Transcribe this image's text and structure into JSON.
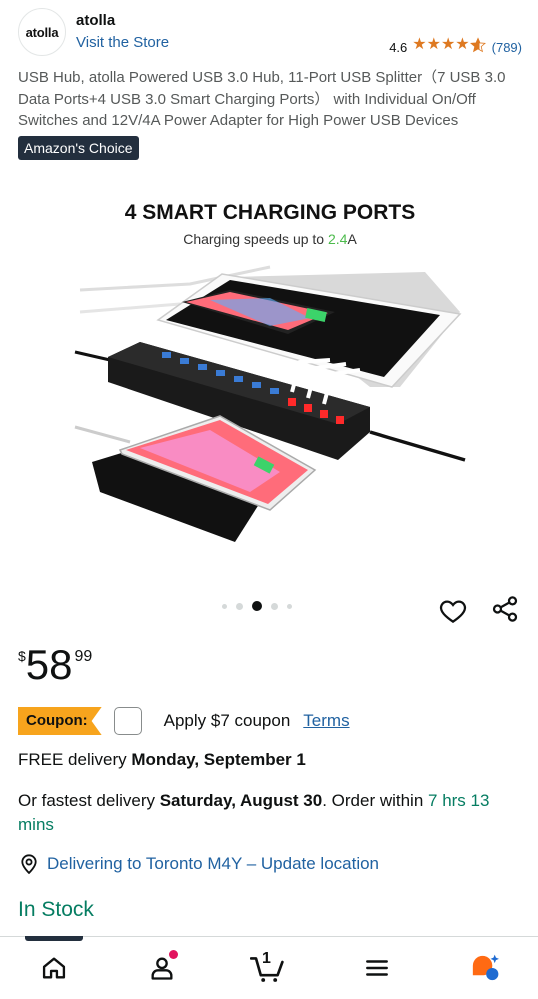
{
  "store": {
    "logo_text": "atolla",
    "name": "atolla",
    "visit_label": "Visit the Store",
    "rating": "4.6",
    "rating_count": "(789)"
  },
  "product": {
    "title": "USB Hub, atolla Powered USB 3.0 Hub, 11-Port USB Splitter（7 USB 3.0 Data Ports+4 USB 3.0 Smart Charging Ports） with Individual On/Off Switches and 12V/4A Power Adapter for High Power USB Devices",
    "badge": "Amazon's Choice",
    "image": {
      "heading": "4 SMART CHARGING PORTS",
      "subheading_prefix": "Charging speeds up to ",
      "subheading_value": "2.4",
      "subheading_suffix": "A"
    },
    "carousel": {
      "count": 5,
      "active_index": 2
    }
  },
  "price": {
    "symbol": "$",
    "whole": "58",
    "fraction": "99"
  },
  "coupon": {
    "badge": "Coupon:",
    "text": "Apply $7 coupon",
    "terms": "Terms"
  },
  "delivery": {
    "free_prefix": "FREE delivery ",
    "free_date": "Monday, September 1",
    "fast_prefix": "Or fastest delivery ",
    "fast_date": "Saturday, August 30",
    "order_within": ". Order within ",
    "countdown": "7 hrs 13 mins",
    "location": "Delivering to Toronto M4Y – Update location"
  },
  "stock": "In Stock",
  "nav": {
    "cart_count": "1"
  },
  "colors": {
    "accent_link": "#2162a1",
    "star": "#de7921",
    "in_stock": "#067d62",
    "coupon": "#f7a41d",
    "badge_bg": "#232f3e",
    "notification": "#e2135e"
  },
  "icons": [
    "star-icon",
    "heart-icon",
    "share-icon",
    "location-pin-icon",
    "home-icon",
    "account-icon",
    "cart-icon",
    "menu-icon",
    "assistant-icon"
  ]
}
